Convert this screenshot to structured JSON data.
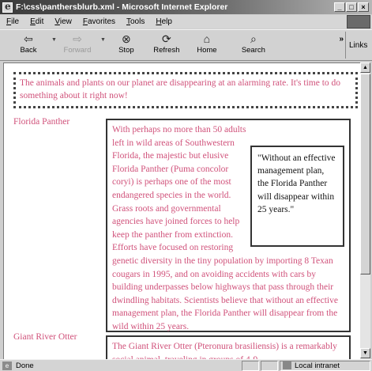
{
  "window": {
    "title": "F:\\css\\panthersblurb.xml - Microsoft Internet Explorer",
    "controls": [
      "_",
      "□",
      "×"
    ]
  },
  "menu": [
    "File",
    "Edit",
    "View",
    "Favorites",
    "Tools",
    "Help"
  ],
  "toolbar": {
    "back": "Back",
    "forward": "Forward",
    "stop": "Stop",
    "refresh": "Refresh",
    "home": "Home",
    "search": "Search",
    "more": "»",
    "links": "Links"
  },
  "content": {
    "intro": "The animals and plants on our planet are disappearing at an alarming rate. It's time to do something about it right now!",
    "animals": [
      {
        "name": "Florida Panther",
        "text": "With perhaps no more than 50 adults left in wild areas of Southwestern Florida, the majestic but elusive Florida Panther (Puma concolor coryi) is perhaps one of the most endangered species in the world. Grass roots and governmental agencies have joined forces to help keep the panther from extinction. Efforts have focused on restoring genetic diversity in the tiny population by importing 8 Texan cougars in 1995, and on avoiding accidents with cars by building underpasses below highways that pass through their dwindling habitats. Scientists believe that without an effective management plan, the Florida Panther will disappear from the wild within 25 years.",
        "quote": "\"Without an effective management plan, the Florida Panther will disappear within 25 years.\""
      },
      {
        "name": "Giant River Otter",
        "text": "The Giant River Otter (Pteronura brasiliensis) is a remarkably social animal, traveling in groups of 4-9"
      }
    ]
  },
  "status": {
    "text": "Done",
    "zone": "Local intranet"
  },
  "colors": {
    "body_text": "#d0517a",
    "quote_text": "#111111"
  }
}
